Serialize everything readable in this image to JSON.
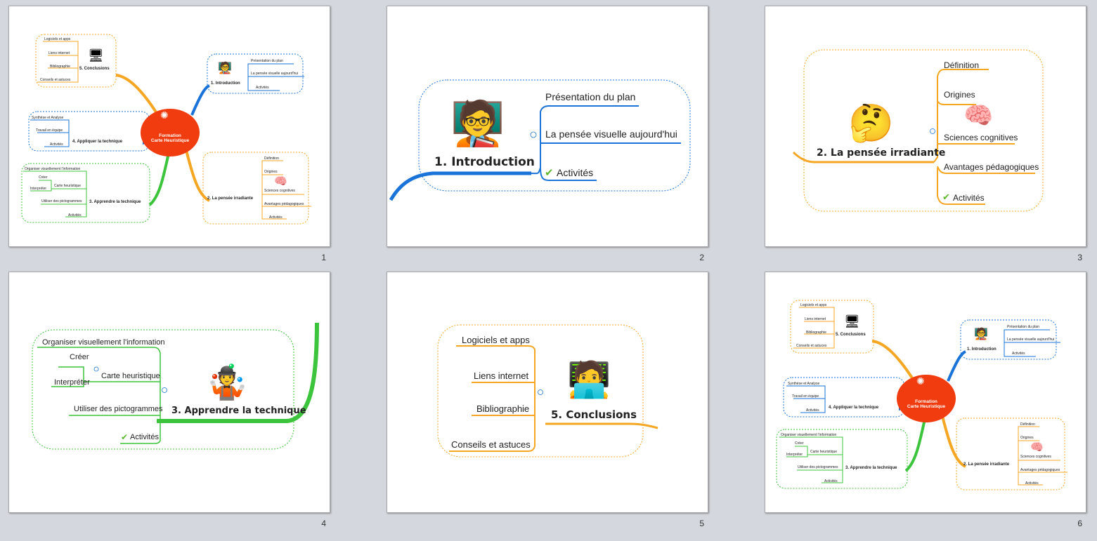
{
  "colors": {
    "introduction": "#1a73d9",
    "pensee": "#f5a623",
    "apprendre": "#3cc43c",
    "appliquer": "#1a73d9",
    "conclusions": "#f5a623",
    "center": "#f03c0f"
  },
  "icons": [
    "presenter-board-icon",
    "brain-icon",
    "thinking-person-icon",
    "juggling-person-icon",
    "computer-user-icon",
    "team-icon",
    "checkmark-icon"
  ],
  "overview": {
    "center_line1": "Formation",
    "center_line2": "Carte Heuristique",
    "introduction": {
      "title": "1. Introduction",
      "items": [
        "Présentation du plan",
        "La pensée visuelle aujourd'hui",
        "Activités"
      ]
    },
    "pensee": {
      "title": "2. La pensée irradiante",
      "items": [
        "Définition",
        "Origines",
        "Sciences cognitives",
        "Avantages pédagogiques",
        "Activités"
      ]
    },
    "apprendre": {
      "title": "3. Apprendre la technique",
      "items": [
        "Organiser visuellement l'information",
        "Créer",
        "Carte heuristique",
        "Interpréter",
        "Utiliser des pictogrammes",
        "Activités"
      ]
    },
    "appliquer": {
      "title": "4. Appliquer la technique",
      "items": [
        "Synthèse et Analyse",
        "Travail en équipe",
        "Activités"
      ]
    },
    "conclusions": {
      "title": "5. Conclusions",
      "items": [
        "Logiciels et apps",
        "Liens internet",
        "Bibliographie",
        "Conseils et astuces"
      ]
    }
  },
  "slides": [
    {
      "number": "1"
    },
    {
      "number": "2",
      "title": "1. Introduction",
      "items": [
        "Présentation du plan",
        "La pensée visuelle aujourd'hui",
        "Activités"
      ]
    },
    {
      "number": "3",
      "title": "2. La pensée irradiante",
      "items": [
        "Définition",
        "Origines",
        "Sciences cognitives",
        "Avantages pédagogiques",
        "Activités"
      ]
    },
    {
      "number": "4",
      "title": "3. Apprendre la technique",
      "items": [
        "Organiser visuellement l'information",
        "Créer",
        "Carte heuristique",
        "Interpréter",
        "Utiliser des pictogrammes",
        "Activités"
      ]
    },
    {
      "number": "5",
      "title": "5. Conclusions",
      "items": [
        "Logiciels et apps",
        "Liens internet",
        "Bibliographie",
        "Conseils et astuces"
      ]
    },
    {
      "number": "6"
    }
  ]
}
